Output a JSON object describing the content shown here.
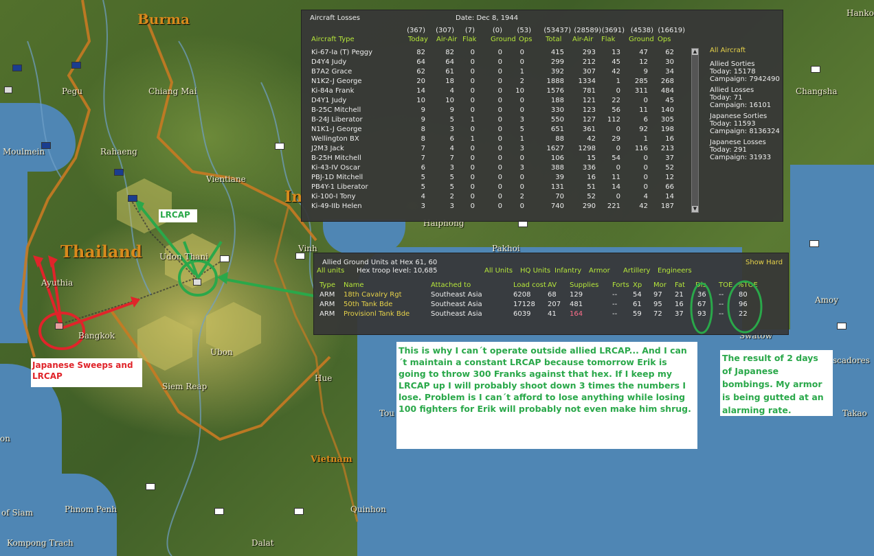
{
  "map": {
    "countries": [
      "Burma",
      "Thailand",
      "Vietnam",
      "In"
    ],
    "cities": [
      "Pegu",
      "Chiang Mai",
      "Moulmein",
      "Rahaeng",
      "Vientiane",
      "Ayuthia",
      "Udon Thani",
      "Vinh",
      "Haiphong",
      "Pakhoi",
      "Bangkok",
      "Ubon",
      "Siem Reap",
      "Hue",
      "Tou",
      "Phnom Penh",
      "Quinhon",
      "Kompong Trach",
      "Dalat",
      "Changsha",
      "Amoy",
      "Swatow",
      "scadores",
      "Takao",
      "Hanko",
      "of Siam",
      "on"
    ]
  },
  "aircraft_losses": {
    "title": "Aircraft Losses",
    "date": "Date: Dec 8, 1944",
    "totals": [
      "(367)",
      "(307)",
      "(7)",
      "(0)",
      "(53)",
      "(53437)",
      "(28589)",
      "(3691)",
      "(4538)",
      "(16619)"
    ],
    "headers": [
      "Aircraft Type",
      "Today",
      "Air-Air",
      "Flak",
      "Ground",
      "Ops",
      "Total",
      "Air-Air",
      "Flak",
      "Ground",
      "Ops"
    ],
    "rows": [
      [
        "Ki-67-Ia (T) Peggy",
        "82",
        "82",
        "0",
        "0",
        "0",
        "415",
        "293",
        "13",
        "47",
        "62"
      ],
      [
        "D4Y4 Judy",
        "64",
        "64",
        "0",
        "0",
        "0",
        "299",
        "212",
        "45",
        "12",
        "30"
      ],
      [
        "B7A2 Grace",
        "62",
        "61",
        "0",
        "0",
        "1",
        "392",
        "307",
        "42",
        "9",
        "34"
      ],
      [
        "N1K2-J George",
        "20",
        "18",
        "0",
        "0",
        "2",
        "1888",
        "1334",
        "1",
        "285",
        "268"
      ],
      [
        "Ki-84a Frank",
        "14",
        "4",
        "0",
        "0",
        "10",
        "1576",
        "781",
        "0",
        "311",
        "484"
      ],
      [
        "D4Y1 Judy",
        "10",
        "10",
        "0",
        "0",
        "0",
        "188",
        "121",
        "22",
        "0",
        "45"
      ],
      [
        "B-25C Mitchell",
        "9",
        "9",
        "0",
        "0",
        "0",
        "330",
        "123",
        "56",
        "11",
        "140"
      ],
      [
        "B-24J Liberator",
        "9",
        "5",
        "1",
        "0",
        "3",
        "550",
        "127",
        "112",
        "6",
        "305"
      ],
      [
        "N1K1-J George",
        "8",
        "3",
        "0",
        "0",
        "5",
        "651",
        "361",
        "0",
        "92",
        "198"
      ],
      [
        "Wellington BX",
        "8",
        "6",
        "1",
        "0",
        "1",
        "88",
        "42",
        "29",
        "1",
        "16"
      ],
      [
        "J2M3 Jack",
        "7",
        "4",
        "0",
        "0",
        "3",
        "1627",
        "1298",
        "0",
        "116",
        "213"
      ],
      [
        "B-25H Mitchell",
        "7",
        "7",
        "0",
        "0",
        "0",
        "106",
        "15",
        "54",
        "0",
        "37"
      ],
      [
        "Ki-43-IV Oscar",
        "6",
        "3",
        "0",
        "0",
        "3",
        "388",
        "336",
        "0",
        "0",
        "52"
      ],
      [
        "PBJ-1D Mitchell",
        "5",
        "5",
        "0",
        "0",
        "0",
        "39",
        "16",
        "11",
        "0",
        "12"
      ],
      [
        "PB4Y-1 Liberator",
        "5",
        "5",
        "0",
        "0",
        "0",
        "131",
        "51",
        "14",
        "0",
        "66"
      ],
      [
        "Ki-100-I Tony",
        "4",
        "2",
        "0",
        "0",
        "2",
        "70",
        "52",
        "0",
        "4",
        "14"
      ],
      [
        "Ki-49-IIb Helen",
        "3",
        "3",
        "0",
        "0",
        "0",
        "740",
        "290",
        "221",
        "42",
        "187"
      ]
    ],
    "side": {
      "all_aircraft": "All Aircraft",
      "allied_sorties": "Allied Sorties",
      "allied_sorties_today": "Today:   15178",
      "allied_sorties_campaign": "Campaign: 7942490",
      "allied_losses": "Allied Losses",
      "allied_losses_today": "Today:   71",
      "allied_losses_campaign": "Campaign: 16101",
      "japanese_sorties": "Japanese Sorties",
      "japanese_sorties_today": "Today:   11593",
      "japanese_sorties_campaign": "Campaign: 8136324",
      "japanese_losses": "Japanese Losses",
      "japanese_losses_today": "Today:   291",
      "japanese_losses_campaign": "Campaign: 31933"
    }
  },
  "ground_units": {
    "title": "Allied Ground Units at Hex 61, 60",
    "all_units_label": "All units",
    "troop_level": "Hex troop level: 10,685",
    "filters": [
      "All Units",
      "HQ Units",
      "Infantry",
      "Armor",
      "Artillery",
      "Engineers"
    ],
    "show_hard": "Show Hard",
    "headers": [
      "Type",
      "Name",
      "Attached to",
      "Load cost",
      "AV",
      "Supplies",
      "Forts",
      "Xp",
      "Mor",
      "Fat",
      "Dis",
      "TOE",
      "%TOE"
    ],
    "rows": [
      [
        "ARM",
        "18th Cavalry Rgt",
        "Southeast Asia",
        "6208",
        "68",
        "129",
        "--",
        "54",
        "97",
        "21",
        "36",
        "--",
        "80"
      ],
      [
        "ARM",
        "50th Tank Bde",
        "Southeast Asia",
        "17128",
        "207",
        "481",
        "--",
        "61",
        "95",
        "16",
        "67",
        "--",
        "96"
      ],
      [
        "ARM",
        "Provisionl Tank Bde",
        "Southeast Asia",
        "6039",
        "41",
        "164",
        "--",
        "59",
        "72",
        "37",
        "93",
        "--",
        "22"
      ]
    ]
  },
  "annotations": {
    "lrcap": "LRCAP",
    "japanese_sweeps": "Japanese Sweeps and LRCAP",
    "main_comment": "This is why I can´t operate outside allied LRCAP... And I can´t maintain a constant LRCAP because tomorrow Erik is going to throw 300 Franks against that hex. If I keep my LRCAP up I will probably shoot down 3 times the numbers I lose. Problem is I can´t afford to lose anything while losing 100 fighters for Erik will probably not even make him shrug.",
    "result_comment": "The result of 2 days of Japanese bombings. My armor is being gutted at an alarming rate."
  },
  "colors": {
    "panel_bg": "#373737",
    "panel_header": "#b7e83a",
    "low_supply": "#ff6f8b",
    "annotation_green": "#2aa84a",
    "annotation_red": "#e0242a",
    "sea": "#4f86b4",
    "border_orange": "#c87a22"
  }
}
